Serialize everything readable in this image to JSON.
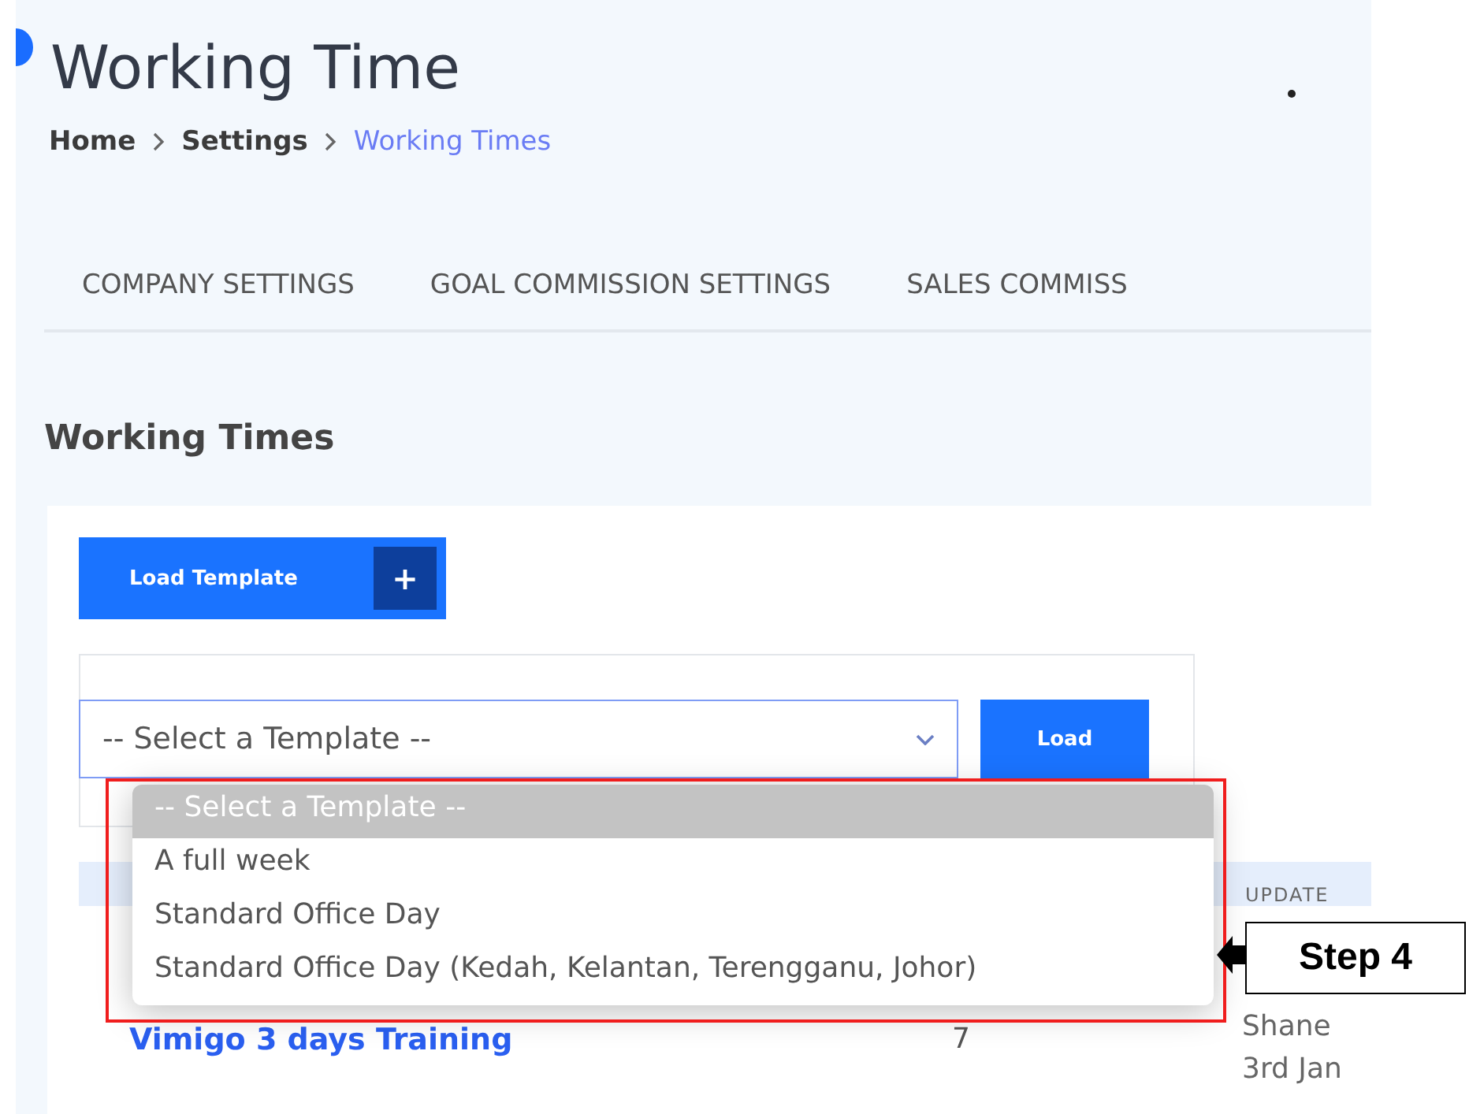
{
  "page": {
    "title": "Working Time"
  },
  "breadcrumb": [
    {
      "label": "Home",
      "current": false
    },
    {
      "label": "Settings",
      "current": false
    },
    {
      "label": "Working Times",
      "current": true
    }
  ],
  "tabs": [
    {
      "label": "COMPANY SETTINGS",
      "selected": false
    },
    {
      "label": "GOAL COMMISSION SETTINGS",
      "selected": false
    },
    {
      "label": "SALES COMMISS",
      "selected": false
    }
  ],
  "section": {
    "heading": "Working Times"
  },
  "load_template_button": {
    "label": "Load Template",
    "icon": "+"
  },
  "template_select": {
    "value": "-- Select a Template --",
    "expanded": true
  },
  "load_button": {
    "label": "Load"
  },
  "dropdown_options": [
    {
      "label": "-- Select a Template --",
      "selected": true
    },
    {
      "label": "A full week",
      "selected": false
    },
    {
      "label": "Standard Office Day",
      "selected": false
    },
    {
      "label": "Standard Office Day (Kedah, Kelantan, Terengganu, Johor)",
      "selected": false
    }
  ],
  "table": {
    "columns": [
      {
        "label": "UPDATE"
      }
    ],
    "rows": [
      {
        "name": "Vimigo 3 days Training",
        "count": "7",
        "updated_by": "Shane",
        "updated_on": "3rd Jan"
      }
    ]
  },
  "annotation": {
    "label": "Step 4"
  }
}
